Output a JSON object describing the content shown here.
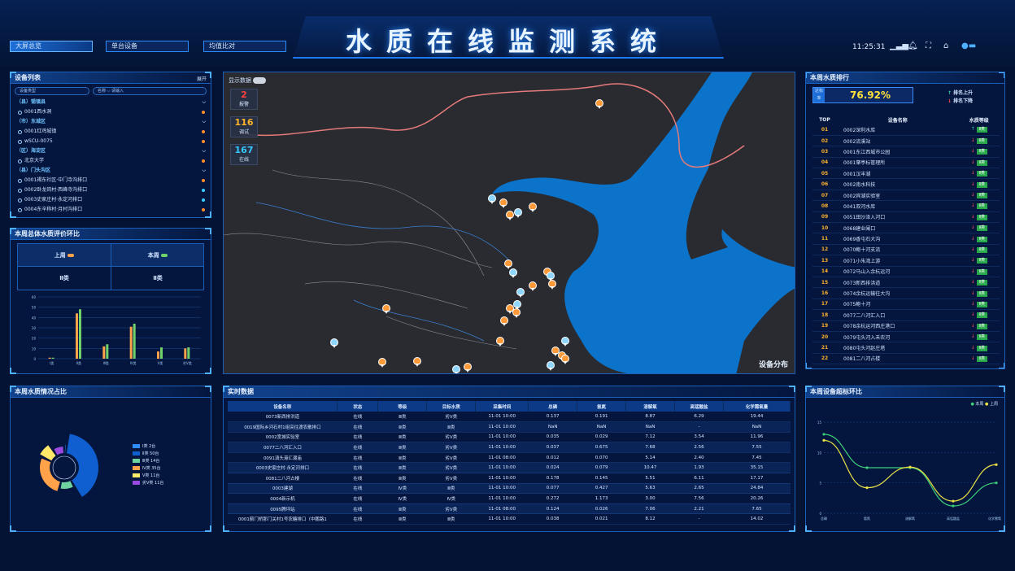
{
  "app_title": "水质在线监测系统",
  "nav": [
    "大屏总览",
    "单台设备",
    "均值比对"
  ],
  "clock": "11:25:31",
  "device_list": {
    "title": "设备列表",
    "expand": "展开",
    "filter1": "设备类型",
    "filter2": "名称",
    "filter_placeholder": "请输入",
    "items": [
      {
        "type": "grp",
        "label": "（县）锡镇县"
      },
      {
        "type": "dev",
        "label": "0001西水洞",
        "dot": "#ff8a2a"
      },
      {
        "type": "grp",
        "label": "（市）东城区"
      },
      {
        "type": "dev",
        "label": "0001红鸡城镇",
        "dot": "#ff8a2a"
      },
      {
        "type": "dev",
        "label": "wSCU-0075",
        "dot": "#ff8a2a"
      },
      {
        "type": "grp",
        "label": "（区）海淀区"
      },
      {
        "type": "dev",
        "label": "北京大学",
        "dot": "#ff8a2a"
      },
      {
        "type": "grp",
        "label": "（县）门头沟区"
      },
      {
        "type": "dev",
        "label": "0001褐东社区·中门寺沟排口",
        "dot": "#ff8a2a"
      },
      {
        "type": "dev",
        "label": "0002卧龙岗村·西峰寺沟排口",
        "dot": "#35d0ff"
      },
      {
        "type": "dev",
        "label": "0003史家庄村·永定河排口",
        "dot": "#35d0ff"
      },
      {
        "type": "dev",
        "label": "0004东辛称村·月村沟排口",
        "dot": "#ff8a2a"
      }
    ]
  },
  "weekly_eval": {
    "title": "本周总体水质评价环比",
    "last_week": "上周",
    "this_week": "本周",
    "last_val": "Ⅱ类",
    "this_val": "Ⅱ类"
  },
  "bar_chart": {
    "yticks": [
      "60",
      "50",
      "40",
      "30",
      "20",
      "10",
      "0"
    ],
    "xlabels": [
      "Ⅰ类",
      "Ⅱ类",
      "Ⅲ类",
      "Ⅳ类",
      "Ⅴ类",
      "劣Ⅴ类"
    ]
  },
  "chart_data": [
    {
      "type": "bar",
      "categories": [
        "Ⅰ类",
        "Ⅱ类",
        "Ⅲ类",
        "Ⅳ类",
        "Ⅴ类",
        "劣Ⅴ类"
      ],
      "ylim": [
        0,
        60
      ],
      "series": [
        {
          "values": [
            1,
            44,
            12,
            31,
            7,
            10
          ]
        },
        {
          "values": [
            1,
            48,
            14,
            34,
            11,
            11
          ]
        }
      ]
    },
    {
      "type": "line",
      "categories": [
        "总磷",
        "氨氮",
        "溶解氧",
        "高锰酸盐",
        "化学需氧量"
      ],
      "ylim": [
        0,
        15
      ],
      "legend": [
        "本周",
        "上周"
      ],
      "series": [
        {
          "name": "本周",
          "values": [
            13,
            7.5,
            7.5,
            1.2,
            5
          ]
        },
        {
          "name": "上周",
          "values": [
            12,
            4.2,
            7.6,
            2,
            8
          ]
        }
      ]
    },
    {
      "type": "pie",
      "title": "本周水质情况占比",
      "labels": [
        "Ⅰ类 2台",
        "Ⅱ类 50台",
        "Ⅲ类 14台",
        "Ⅳ类 35台",
        "Ⅴ类 11台",
        "劣Ⅴ类 11台"
      ],
      "values": [
        2,
        50,
        14,
        35,
        11,
        11
      ],
      "colors": [
        "#2f8cff",
        "#0f5fd0",
        "#6fd3a0",
        "#ffa24a",
        "#ffe86a",
        "#9b4ae0"
      ]
    }
  ],
  "weekly_dist": {
    "title": "本周水质情况占比"
  },
  "map": {
    "toggle_label": "显示数据",
    "stats": [
      {
        "num": "2",
        "label": "报警",
        "color": "#ff4040"
      },
      {
        "num": "116",
        "label": "调试",
        "color": "#ffb32a"
      },
      {
        "num": "167",
        "label": "在线",
        "color": "#35c8ff"
      }
    ],
    "caption": "设备分布"
  },
  "realtime": {
    "title": "实时数据",
    "headers": [
      "设备名称",
      "状态",
      "等级",
      "目标水质",
      "采集时间",
      "总磷",
      "氨氮",
      "溶解氧",
      "高锰酸盐",
      "化学需氧量"
    ],
    "rows": [
      [
        "0073新西排洪道",
        "在线",
        "Ⅲ类",
        "劣Ⅴ类",
        "11-01 10:00",
        "0.137",
        "0.191",
        "8.87",
        "6.29",
        "19.44"
      ],
      [
        "0019国际乡河石村1组突往渡农散排口",
        "在线",
        "Ⅲ类",
        "Ⅲ类",
        "11-01 10:00",
        "NaN",
        "NaN",
        "NaN",
        "-",
        "NaN"
      ],
      [
        "0002宽城实验室",
        "在线",
        "Ⅲ类",
        "劣Ⅴ类",
        "11-01 10:00",
        "0.035",
        "0.029",
        "7.12",
        "3.54",
        "11.96"
      ],
      [
        "0077二八河汇入口",
        "在线",
        "Ⅲ类",
        "劣Ⅴ类",
        "11-01 10:00",
        "0.037",
        "0.675",
        "7.68",
        "2.56",
        "7.55"
      ],
      [
        "0091滇头港汇潮庙",
        "在线",
        "Ⅲ类",
        "劣Ⅴ类",
        "11-01 08:00",
        "0.012",
        "0.070",
        "5.14",
        "2.40",
        "7.45"
      ],
      [
        "0003史家庄村·永定河排口",
        "在线",
        "Ⅲ类",
        "劣Ⅴ类",
        "11-01 10:00",
        "0.024",
        "0.079",
        "10.47",
        "1.93",
        "35.15"
      ],
      [
        "0081二八河占楼",
        "在线",
        "Ⅲ类",
        "劣Ⅴ类",
        "11-01 10:00",
        "0.178",
        "0.145",
        "5.51",
        "6.11",
        "17.17"
      ],
      [
        "0003建湖",
        "在线",
        "Ⅳ类",
        "Ⅲ类",
        "11-01 10:00",
        "0.077",
        "0.427",
        "5.63",
        "2.65",
        "24.84"
      ],
      [
        "0004新示机",
        "在线",
        "Ⅳ类",
        "Ⅳ类",
        "11-01 10:00",
        "0.272",
        "1.173",
        "3.00",
        "7.56",
        "20.26"
      ],
      [
        "0095腾坪站",
        "在线",
        "Ⅲ类",
        "劣Ⅴ类",
        "11-01 08:00",
        "0.124",
        "0.026",
        "7.06",
        "2.21",
        "7.65"
      ],
      [
        "0001蓟门桥那门关村1号农糖排口（中鹏路1",
        "在线",
        "Ⅲ类",
        "Ⅲ类",
        "11-01 10:00",
        "0.038",
        "0.021",
        "8.12",
        "-",
        "14.02"
      ]
    ]
  },
  "ranking": {
    "title": "本周水质排行",
    "score_label": "达标率",
    "score": "76.92%",
    "up_label": "排名上升",
    "down_label": "排名下降",
    "headers": [
      "TOP",
      "设备名称",
      "水质等级"
    ],
    "rows": [
      [
        "01",
        "0002深利水库",
        "up"
      ],
      [
        "02",
        "0002流溪站",
        "down"
      ],
      [
        "03",
        "0001东江西城市公园",
        "down"
      ],
      [
        "04",
        "0001肇亭标管理所",
        "down"
      ],
      [
        "05",
        "0001汉丰湖",
        "down"
      ],
      [
        "06",
        "0002南水科技",
        "down"
      ],
      [
        "07",
        "0002宾湖实验室",
        "down"
      ],
      [
        "08",
        "0041双河水库",
        "down"
      ],
      [
        "09",
        "0051田沙泽入河口",
        "down"
      ],
      [
        "10",
        "0068建业阑口",
        "down"
      ],
      [
        "11",
        "0069香屯石大沟",
        "down"
      ],
      [
        "12",
        "0070鲍十河支流",
        "down"
      ],
      [
        "13",
        "0071小朱湾上游",
        "down"
      ],
      [
        "14",
        "0072马山入余杭运河",
        "down"
      ],
      [
        "15",
        "0073新西排洪道",
        "down"
      ],
      [
        "16",
        "0074余杭运输往大沟",
        "down"
      ],
      [
        "17",
        "0075鲍十河",
        "down"
      ],
      [
        "18",
        "0077二八河汇入口",
        "down"
      ],
      [
        "19",
        "0078余杭运河西庄港口",
        "down"
      ],
      [
        "20",
        "0079屯头河入禾农河",
        "down"
      ],
      [
        "21",
        "0080屯头河赵庄塔",
        "down"
      ],
      [
        "22",
        "0081二八河占楼",
        "down"
      ]
    ],
    "grade": "Ⅱ类"
  },
  "exceed": {
    "title": "本周设备超标环比",
    "legend_this": "本周",
    "legend_last": "上周",
    "yticks": [
      "15",
      "10",
      "5",
      "0"
    ],
    "xlabels": [
      "总磷",
      "氨氮",
      "溶解氧",
      "高锰酸盐",
      "化学需氧量"
    ]
  },
  "colors": {
    "accent": "#2f8cff",
    "bar1": "#ffa24a",
    "bar2": "#6fd36a",
    "line_this": "#3dd07a",
    "line_last": "#e8e045"
  }
}
